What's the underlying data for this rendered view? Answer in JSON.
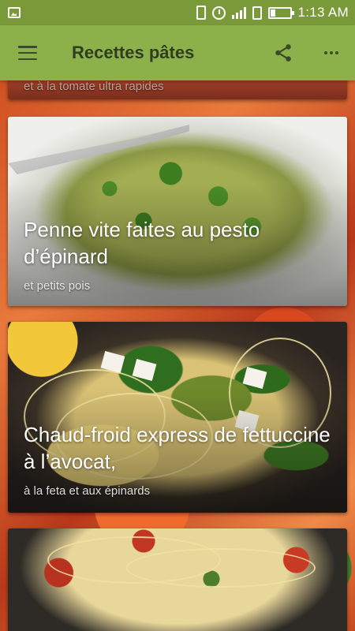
{
  "status_bar": {
    "time": "1:13 AM",
    "icons": [
      "image-icon",
      "vibrate-icon",
      "alarm-icon",
      "signal-icon",
      "sim-icon",
      "battery-icon"
    ]
  },
  "app_bar": {
    "title": "Recettes pâtes",
    "icons": [
      "menu-icon",
      "share-icon",
      "more-icon"
    ],
    "background_color": "#8cb14a"
  },
  "cards": [
    {
      "title": "",
      "subtitle": "et à la tomate ultra rapides"
    },
    {
      "title": "Penne vite faites au pesto d’épinard",
      "subtitle": "et petits pois"
    },
    {
      "title": "Chaud-froid express de fettuccine à l’avocat,",
      "subtitle": "à la feta et aux épinards"
    },
    {
      "title": "",
      "subtitle": ""
    }
  ]
}
